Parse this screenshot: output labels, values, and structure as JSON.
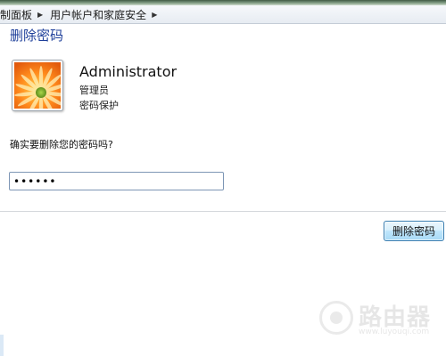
{
  "breadcrumb": {
    "items": [
      "制面板",
      "用户帐户和家庭安全"
    ]
  },
  "page": {
    "title": "删除密码"
  },
  "user": {
    "name": "Administrator",
    "role": "管理员",
    "status": "密码保护"
  },
  "form": {
    "question": "确实要删除您的密码吗?",
    "password_value": "••••••"
  },
  "actions": {
    "delete_label": "删除密码"
  },
  "watermark": {
    "title": "路由器",
    "subtitle": "www.luyouqi.com"
  },
  "colors": {
    "title_blue": "#1e3f9a",
    "button_border": "#3c7fb1"
  },
  "icons": {
    "breadcrumb_separator": "chevron-right-icon",
    "user_picture": "flower-avatar"
  }
}
